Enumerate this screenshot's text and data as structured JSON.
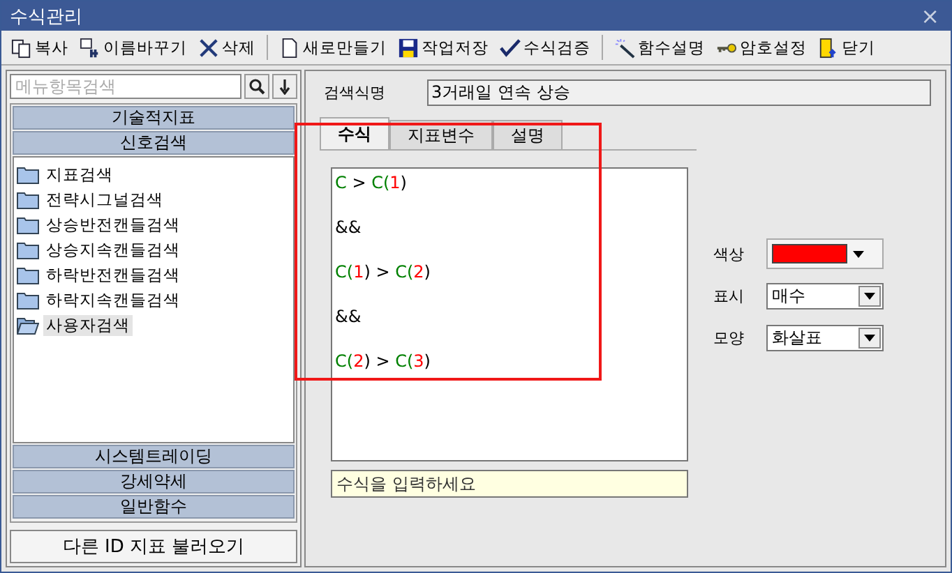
{
  "window": {
    "title": "수식관리",
    "close": "×"
  },
  "toolbar_groups": [
    [
      {
        "label": "복사"
      },
      {
        "label": "이름바꾸기"
      },
      {
        "label": "삭제"
      }
    ],
    [
      {
        "label": "새로만들기"
      },
      {
        "label": "작업저장"
      },
      {
        "label": "수식검증"
      }
    ],
    [
      {
        "label": "함수설명"
      },
      {
        "label": "암호설정"
      },
      {
        "label": "닫기"
      }
    ]
  ],
  "sidebar": {
    "search": {
      "placeholder": "메뉴항목검색"
    },
    "top_categories": [
      {
        "label": "기술적지표"
      },
      {
        "label": "신호검색"
      }
    ],
    "items": [
      {
        "label": "지표검색",
        "selected": false
      },
      {
        "label": "전략시그널검색",
        "selected": false
      },
      {
        "label": "상승반전캔들검색",
        "selected": false
      },
      {
        "label": "상승지속캔들검색",
        "selected": false
      },
      {
        "label": "하락반전캔들검색",
        "selected": false
      },
      {
        "label": "하락지속캔들검색",
        "selected": false
      },
      {
        "label": "사용자검색",
        "selected": true
      }
    ],
    "bottom_categories": [
      {
        "label": "시스템트레이딩"
      },
      {
        "label": "강세약세"
      },
      {
        "label": "일반함수"
      }
    ],
    "load_button": "다른 ID 지표 불러오기"
  },
  "name_field": {
    "label": "검색식명",
    "value": "3거래일 연속 상승"
  },
  "tabs": [
    {
      "label": "수식",
      "selected": true
    },
    {
      "label": "지표변수",
      "selected": false
    },
    {
      "label": "설명",
      "selected": false
    }
  ],
  "formula_lines": [
    [
      {
        "text": "C",
        "kind": "var"
      },
      {
        "text": " > ",
        "kind": "op"
      },
      {
        "text": "C(",
        "kind": "var"
      },
      {
        "text": "1",
        "kind": "num"
      },
      {
        "text": ")",
        "kind": "op"
      }
    ],
    [
      {
        "text": "&&",
        "kind": "op"
      }
    ],
    [
      {
        "text": "C(",
        "kind": "var"
      },
      {
        "text": "1",
        "kind": "num"
      },
      {
        "text": ") > ",
        "kind": "op"
      },
      {
        "text": "C(",
        "kind": "var"
      },
      {
        "text": "2",
        "kind": "num"
      },
      {
        "text": ")",
        "kind": "op"
      }
    ],
    [
      {
        "text": "&&",
        "kind": "op"
      }
    ],
    [
      {
        "text": "C(",
        "kind": "var"
      },
      {
        "text": "2",
        "kind": "num"
      },
      {
        "text": ") > ",
        "kind": "op"
      },
      {
        "text": "C(",
        "kind": "var"
      },
      {
        "text": "3",
        "kind": "num"
      },
      {
        "text": ")",
        "kind": "op"
      }
    ]
  ],
  "hint": {
    "placeholder": "수식을 입력하세요"
  },
  "options": [
    {
      "label": "색상",
      "kind": "color",
      "color": "#ff0000"
    },
    {
      "label": "표시",
      "kind": "select",
      "value": "매수"
    },
    {
      "label": "모양",
      "kind": "select",
      "value": "화살표"
    }
  ],
  "highlight_frame": true
}
